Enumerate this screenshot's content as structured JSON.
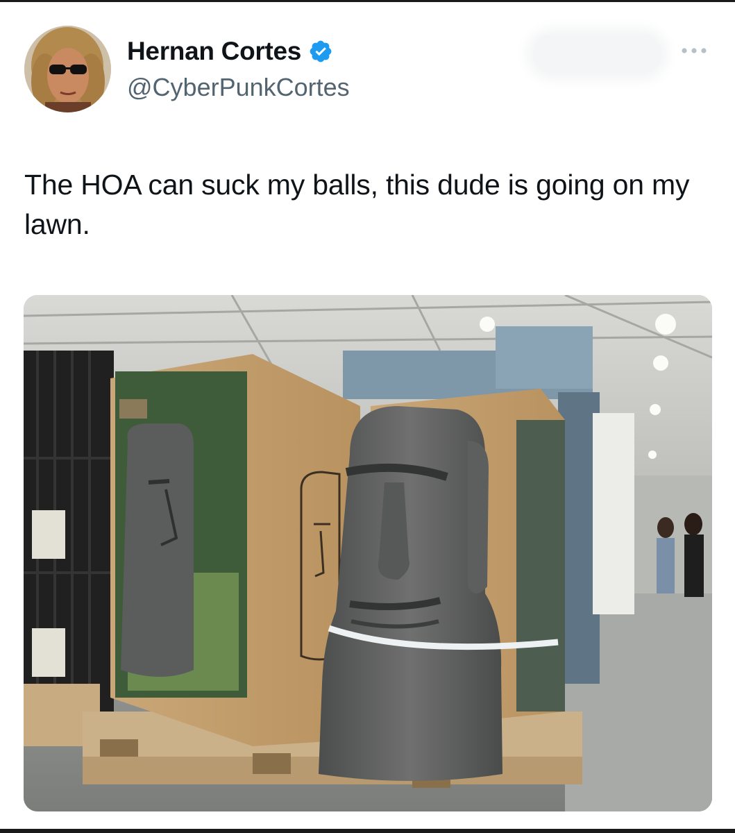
{
  "tweet": {
    "author": {
      "display_name": "Hernan Cortes",
      "handle": "@CyberPunkCortes",
      "verified_icon": "verified-badge-icon",
      "verified_color": "#1d9bf0"
    },
    "text": "The HOA can suck my balls, this dude is going on my lawn.",
    "more_icon": "more-options-icon",
    "media": {
      "kind": "photo",
      "description_icon": "photo"
    }
  },
  "colors": {
    "text_primary": "#0f1419",
    "text_secondary": "#536471",
    "accent": "#1d9bf0"
  }
}
